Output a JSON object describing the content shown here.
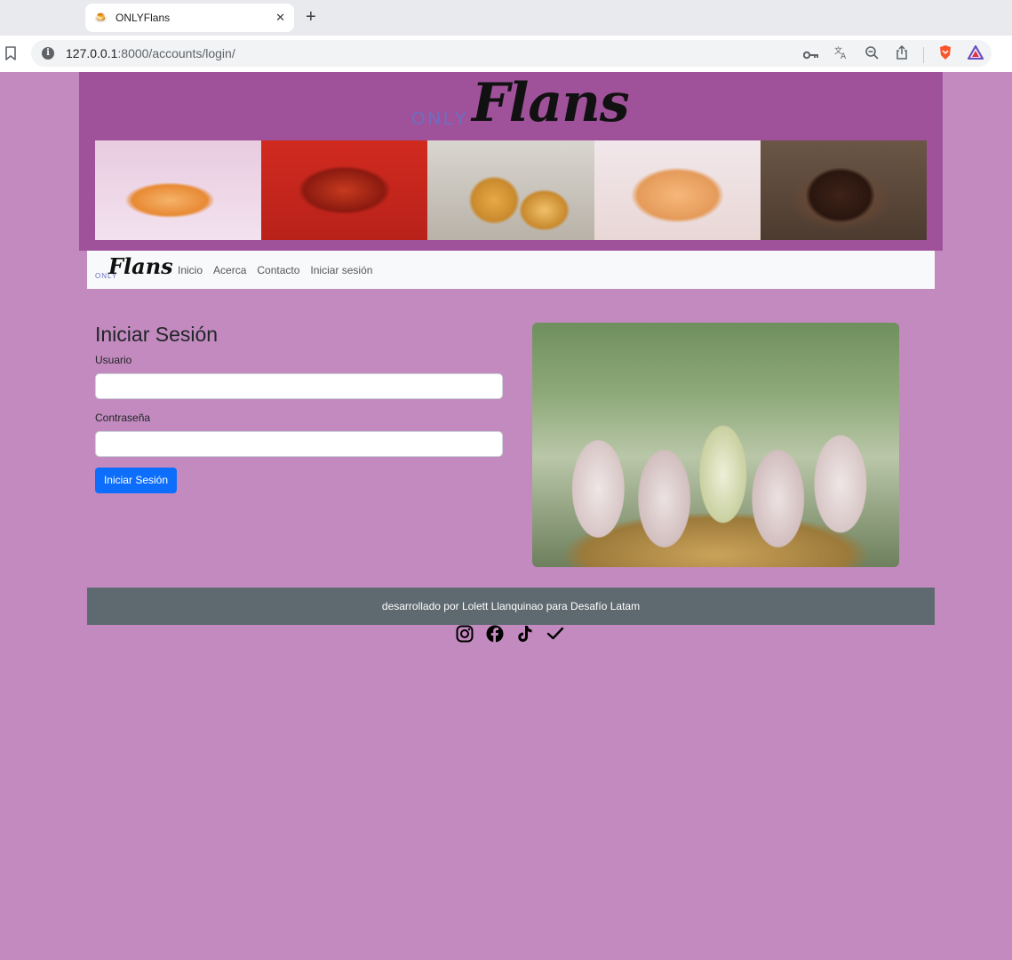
{
  "browser": {
    "tab_title": "ONLYFlans",
    "tab_favicon": "🍮",
    "url_host": "127.0.0.1",
    "url_rest": ":8000/accounts/login/"
  },
  "header": {
    "logo_only": "ONLY",
    "logo_flans": "Flans"
  },
  "navbar": {
    "logo_only": "ONLY",
    "logo_flans": "Flans",
    "links": [
      "Inicio",
      "Acerca",
      "Contacto",
      "Iniciar sesión"
    ]
  },
  "login": {
    "title": "Iniciar Sesión",
    "username_label": "Usuario",
    "username_value": "",
    "password_label": "Contraseña",
    "password_value": "",
    "submit_label": "Iniciar Sesión"
  },
  "footer": {
    "text": "desarrollado por Lolett Llanquinao para Desafío Latam",
    "social_icons": [
      "instagram-icon",
      "facebook-icon",
      "tiktok-icon",
      "checkmark-icon"
    ]
  },
  "colors": {
    "page_bg": "#c28abe",
    "header_bg": "#9f529a",
    "footer_bg": "#5f6a70",
    "button_bg": "#0d6efd"
  }
}
